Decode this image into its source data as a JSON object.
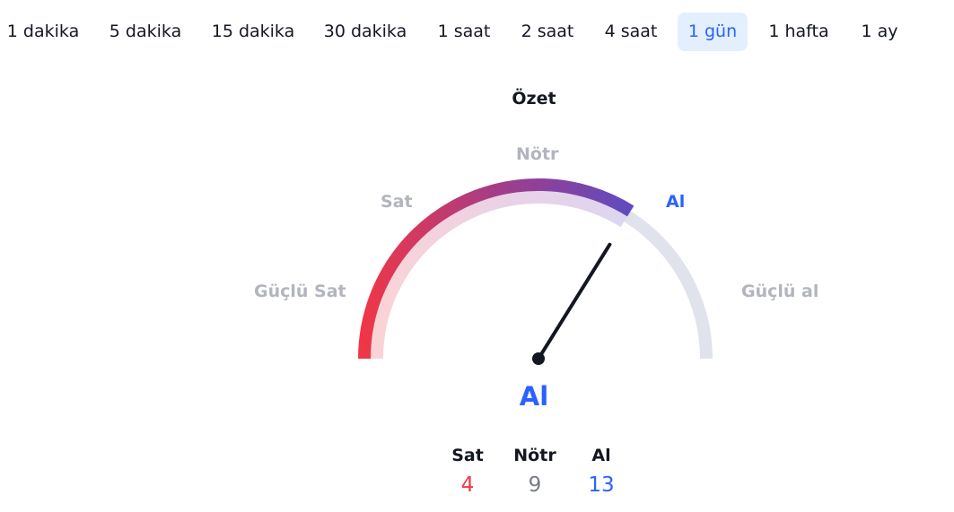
{
  "intervals": {
    "tabs": [
      {
        "label": "1 dakika"
      },
      {
        "label": "5 dakika"
      },
      {
        "label": "15 dakika"
      },
      {
        "label": "30 dakika"
      },
      {
        "label": "1 saat"
      },
      {
        "label": "2 saat"
      },
      {
        "label": "4 saat"
      },
      {
        "label": "1 gün",
        "active": true
      },
      {
        "label": "1 hafta"
      },
      {
        "label": "1 ay"
      }
    ]
  },
  "summary": {
    "title": "Özet",
    "gauge": {
      "labels": {
        "strong_sell": "Güçlü Sat",
        "sell": "Sat",
        "neutral": "Nötr",
        "buy": "Al",
        "strong_buy": "Güçlü al"
      },
      "value": 0.355,
      "colors": {
        "sell": "#f23645",
        "neutral": "#9c27b0",
        "buy": "#5b4cc4",
        "track": "#e0e3eb",
        "needle": "#131722"
      }
    },
    "verdict": "Al",
    "counts": {
      "sell": {
        "label": "Sat",
        "value": "4",
        "color": "#f23645"
      },
      "neutral": {
        "label": "Nötr",
        "value": "9",
        "color": "#787b86"
      },
      "buy": {
        "label": "Al",
        "value": "13",
        "color": "#2962ff"
      }
    }
  }
}
